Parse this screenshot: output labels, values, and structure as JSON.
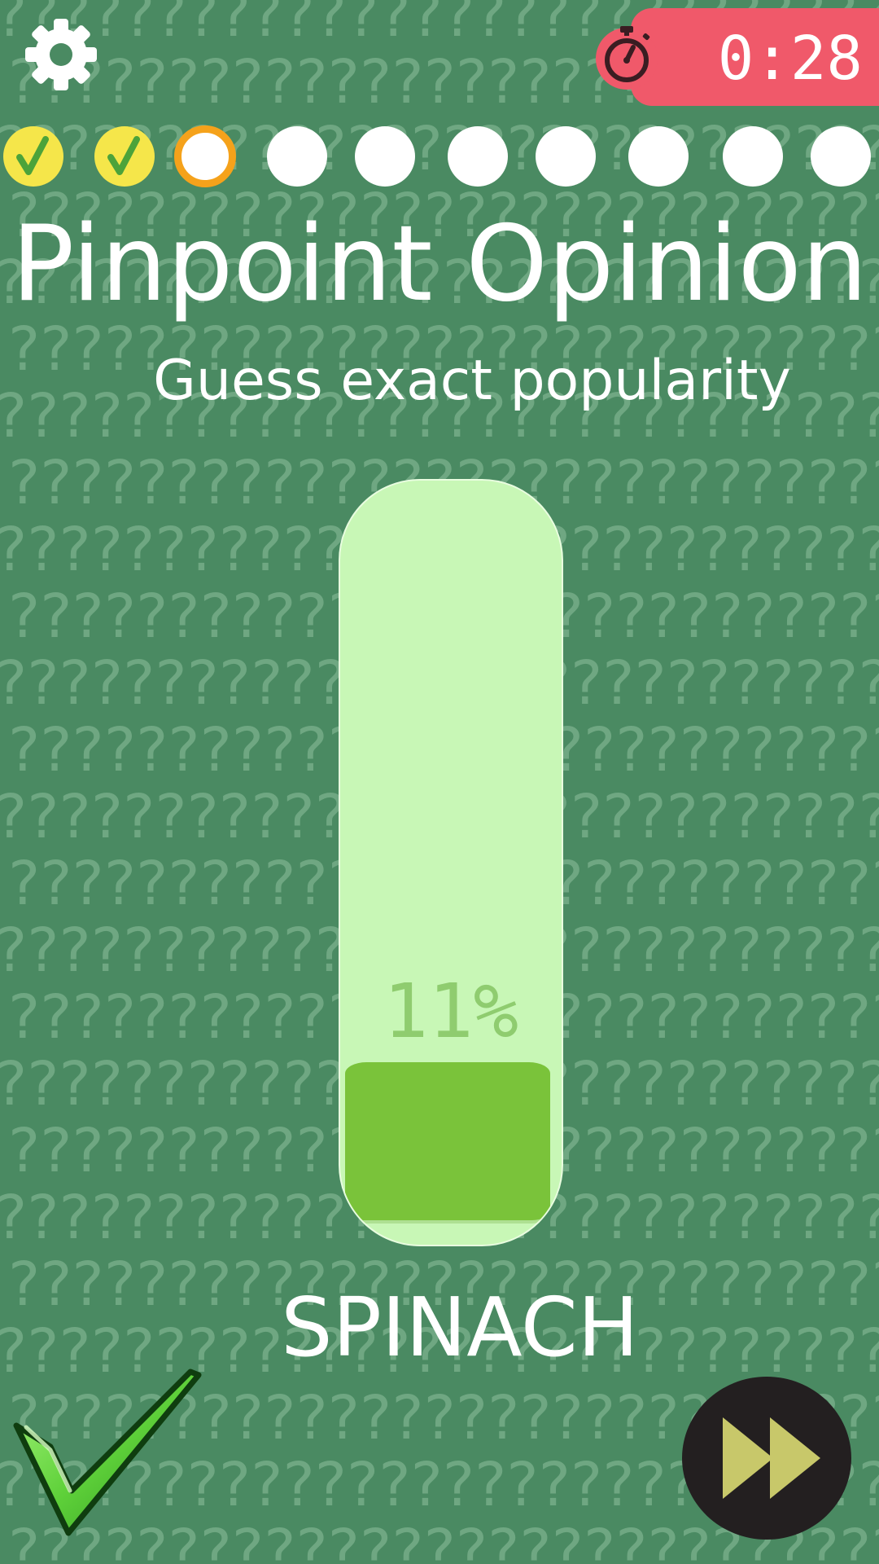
{
  "background": {
    "pattern_glyph": "?",
    "color": "#4a8a62",
    "glyph_color": "#6fa782"
  },
  "toolbar": {
    "settings_icon": "gear-icon"
  },
  "timer": {
    "icon": "stopwatch-icon",
    "value": "0:28",
    "color": "#f0596a"
  },
  "progress": {
    "total": 10,
    "completed": 2,
    "current_index": 2,
    "colors": {
      "done": "#f5e64a",
      "check": "#4ca33a",
      "current_ring": "#f5a21b",
      "pending": "#ffffff"
    }
  },
  "game": {
    "title": "Pinpoint Opinion",
    "subtitle": "Guess exact popularity",
    "item": "SPINACH"
  },
  "meter": {
    "label": "11%",
    "value_percent": 11,
    "bar_color": "#c8f7b6",
    "fill_color": "#7ac33a"
  },
  "actions": {
    "confirm_icon": "checkmark-icon",
    "skip_icon": "fast-forward-icon"
  }
}
